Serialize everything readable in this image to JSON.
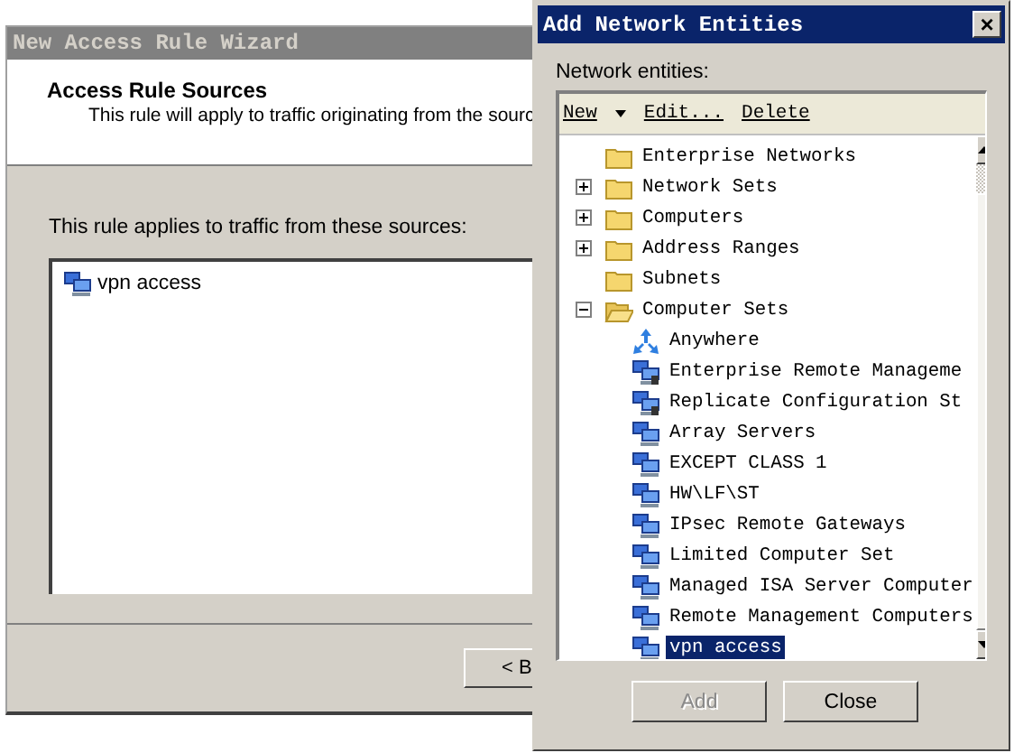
{
  "wizard": {
    "title": "New Access Rule Wizard",
    "heading": "Access Rule Sources",
    "subtitle": "This rule will apply to traffic originating from the sourc",
    "list_label": "This rule applies to traffic from these sources:",
    "sources": [
      {
        "label": "vpn access"
      }
    ],
    "back_button": "< B"
  },
  "dialog": {
    "title": "Add Network Entities",
    "close": "×",
    "label": "Network entities:",
    "toolbar": [
      {
        "label": "New",
        "kind": "menu"
      },
      {
        "label": "Edit...",
        "kind": "plain"
      },
      {
        "label": "Delete",
        "kind": "plain"
      }
    ],
    "tree": [
      {
        "label": "Enterprise Networks",
        "has_children": false,
        "expanded": false,
        "kind": "folder"
      },
      {
        "label": "Network Sets",
        "has_children": true,
        "expanded": false,
        "kind": "folder"
      },
      {
        "label": "Computers",
        "has_children": true,
        "expanded": false,
        "kind": "folder"
      },
      {
        "label": "Address Ranges",
        "has_children": true,
        "expanded": false,
        "kind": "folder"
      },
      {
        "label": "Subnets",
        "has_children": false,
        "expanded": false,
        "kind": "folder"
      },
      {
        "label": "Computer Sets",
        "has_children": true,
        "expanded": true,
        "kind": "folder",
        "children": [
          {
            "label": "Anywhere",
            "kind": "anywhere",
            "selected": false
          },
          {
            "label": "Enterprise Remote Manageme",
            "kind": "locked-set",
            "selected": false
          },
          {
            "label": "Replicate Configuration St",
            "kind": "locked-set",
            "selected": false
          },
          {
            "label": "Array Servers",
            "kind": "set",
            "selected": false
          },
          {
            "label": "EXCEPT CLASS 1",
            "kind": "set",
            "selected": false
          },
          {
            "label": "HW\\LF\\ST",
            "kind": "set",
            "selected": false
          },
          {
            "label": "IPsec Remote Gateways",
            "kind": "set",
            "selected": false
          },
          {
            "label": "Limited Computer Set",
            "kind": "set",
            "selected": false
          },
          {
            "label": "Managed ISA Server Computer",
            "kind": "set",
            "selected": false
          },
          {
            "label": "Remote Management Computers",
            "kind": "set",
            "selected": false
          },
          {
            "label": "vpn access",
            "kind": "set",
            "selected": true
          }
        ]
      }
    ],
    "buttons": [
      {
        "label": "Add",
        "disabled": true
      },
      {
        "label": "Close",
        "disabled": false
      }
    ]
  }
}
